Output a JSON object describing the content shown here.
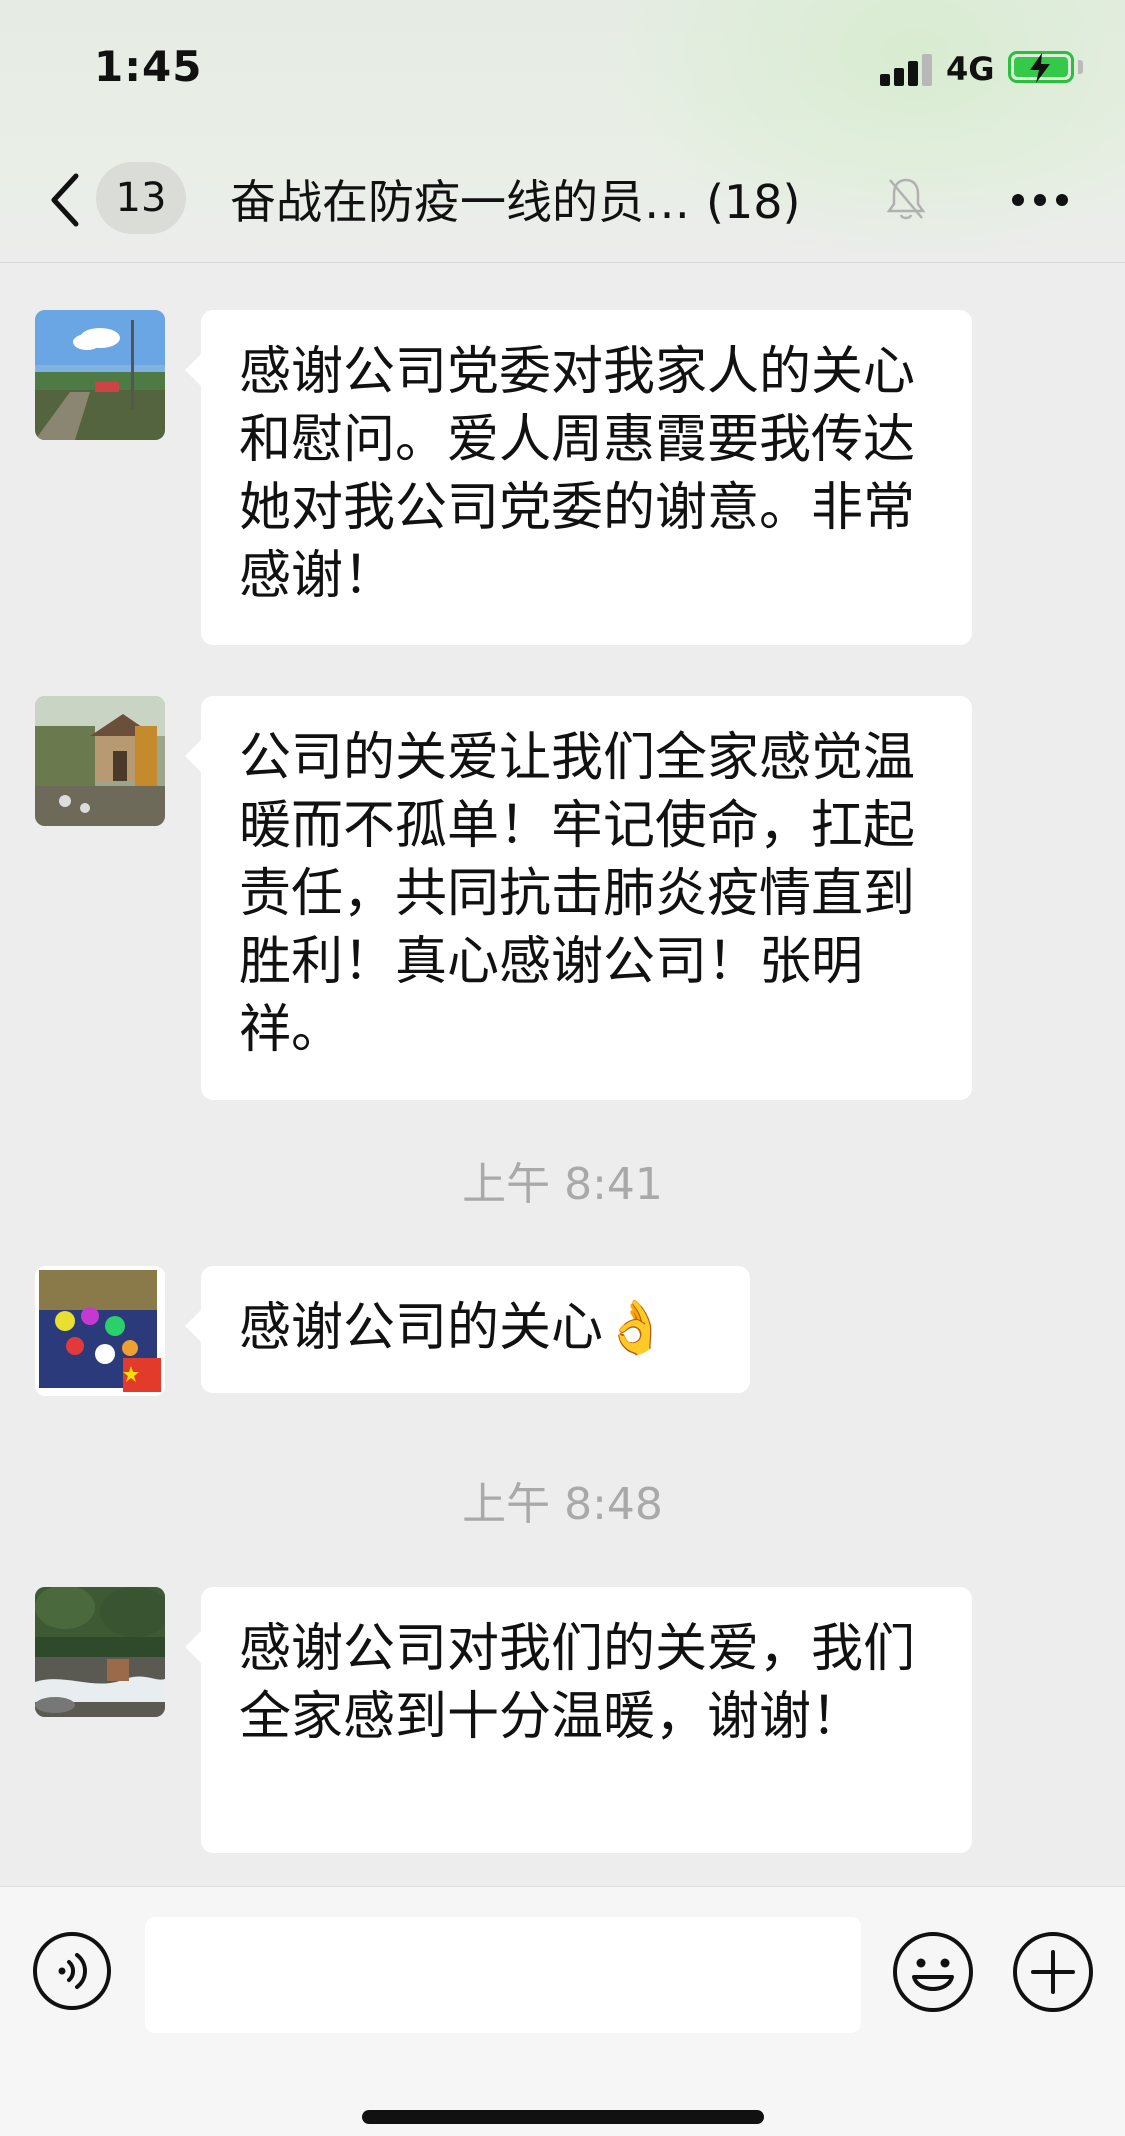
{
  "status_bar": {
    "time": "1:45",
    "network": "4G",
    "battery_icon": "battery-charging-icon",
    "battery_level": 0.85,
    "signal_bars": 3,
    "accent_color": "#2bbf3e"
  },
  "header": {
    "back_icon": "chevron-left-icon",
    "unread_count": "13",
    "title": "奋战在防疫一线的员…",
    "member_count": "(18)",
    "mute_icon": "bell-off-icon",
    "more_icon": "ellipsis-icon"
  },
  "messages": [
    {
      "type": "text",
      "avatar": "avatar-landscape-sky",
      "text": "感谢公司党委对我家人的关心和慰问。爱人周惠霞要我传达她对我公司党委的谢意。非常感谢！"
    },
    {
      "type": "text",
      "avatar": "avatar-village-courtyard",
      "text": "公司的关爱让我们全家感觉温暖而不孤单！牢记使命，扛起责任，共同抗击肺炎疫情直到胜利！真心感谢公司！张明祥。"
    },
    {
      "type": "timestamp",
      "text": "上午 8:41"
    },
    {
      "type": "text",
      "avatar": "avatar-colorful-flag",
      "text": "感谢公司的关心",
      "emoji": "👌"
    },
    {
      "type": "timestamp",
      "text": "上午 8:48"
    },
    {
      "type": "text",
      "avatar": "avatar-mountain-stream",
      "text": "感谢公司对我们的关爱，我们全家感到十分温暖，谢谢！"
    }
  ],
  "input_bar": {
    "voice_icon": "voice-icon",
    "input_value": "",
    "emoji_icon": "emoji-smile-icon",
    "plus_icon": "plus-circle-icon"
  },
  "colors": {
    "background": "#ededed",
    "bubble": "#ffffff",
    "timestamp": "#a9a9a9"
  }
}
